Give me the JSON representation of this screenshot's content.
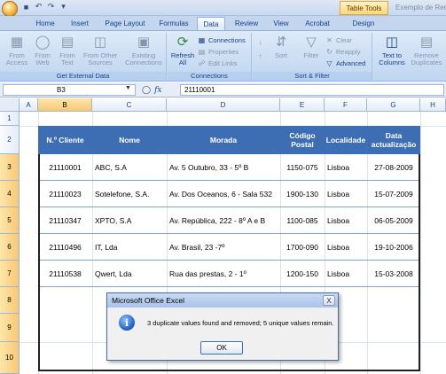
{
  "titlebar": {
    "context_tab": "Table Tools",
    "window_title": "Exemplo de Rem"
  },
  "tabs": [
    {
      "label": "Home"
    },
    {
      "label": "Insert"
    },
    {
      "label": "Page Layout"
    },
    {
      "label": "Formulas"
    },
    {
      "label": "Data",
      "active": true
    },
    {
      "label": "Review"
    },
    {
      "label": "View"
    },
    {
      "label": "Acrobat"
    },
    {
      "label": "Design"
    }
  ],
  "ribbon": {
    "get_external": {
      "label": "Get External Data",
      "from_access": "From\nAccess",
      "from_web": "From\nWeb",
      "from_text": "From\nText",
      "from_other": "From Other\nSources",
      "existing": "Existing\nConnections"
    },
    "connections": {
      "label": "Connections",
      "refresh": "Refresh\nAll",
      "connections": "Connections",
      "properties": "Properties",
      "edit_links": "Edit Links"
    },
    "sort_filter": {
      "label": "Sort & Filter",
      "sort": "Sort",
      "filter": "Filter",
      "clear": "Clear",
      "reapply": "Reapply",
      "advanced": "Advanced"
    },
    "data_tools": {
      "text_to_columns": "Text to\nColumns",
      "remove_duplicates": "Remove\nDuplicates"
    }
  },
  "formula_bar": {
    "name_box": "B3",
    "fx": "fx",
    "value": "21110001"
  },
  "columns": [
    "A",
    "B",
    "C",
    "D",
    "E",
    "F",
    "G",
    "H"
  ],
  "rows": [
    "1",
    "2",
    "3",
    "4",
    "5",
    "6",
    "7",
    "8",
    "9",
    "10"
  ],
  "table": {
    "headers": {
      "cliente": "N.º Cliente",
      "nome": "Nome",
      "morada": "Morada",
      "codigo": "Código\nPostal",
      "localidade": "Localidade",
      "data": "Data\nactualização"
    },
    "records": [
      {
        "cliente": "21110001",
        "nome": "ABC, S.A",
        "morada": "Av. 5 Outubro, 33 - 5º B",
        "codigo": "1150-075",
        "localidade": "Lisboa",
        "data": "27-08-2009"
      },
      {
        "cliente": "21110023",
        "nome": "Sotelefone, S.A.",
        "morada": "Av. Dos Oceanos, 6 - Sala 532",
        "codigo": "1900-130",
        "localidade": "Lisboa",
        "data": "15-07-2009"
      },
      {
        "cliente": "21110347",
        "nome": "XPTO, S.A",
        "morada": "Av. República, 222 - 8º A e B",
        "codigo": "1100-085",
        "localidade": "Lisboa",
        "data": "06-05-2009"
      },
      {
        "cliente": "21110496",
        "nome": "IT, Lda",
        "morada": "Av. Brasil, 23 -7º",
        "codigo": "1700-090",
        "localidade": "Lisboa",
        "data": "19-10-2006"
      },
      {
        "cliente": "21110538",
        "nome": "Qwert, Lda",
        "morada": "Rua das prestas, 2 - 1º",
        "codigo": "1200-150",
        "localidade": "Lisboa",
        "data": "15-03-2008"
      }
    ]
  },
  "dialog": {
    "title": "Microsoft Office Excel",
    "close": "X",
    "message": "3 duplicate values found and removed; 5 unique values remain.",
    "ok": "OK"
  }
}
